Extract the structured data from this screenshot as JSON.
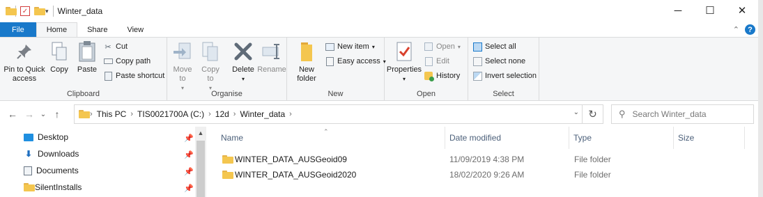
{
  "window": {
    "title": "Winter_data"
  },
  "tabs": [
    "File",
    "Home",
    "Share",
    "View"
  ],
  "ribbon": {
    "clipboard": {
      "label": "Clipboard",
      "pin_to_quick_access": "Pin to Quick access",
      "copy": "Copy",
      "paste": "Paste",
      "cut": "Cut",
      "copy_path": "Copy path",
      "paste_shortcut": "Paste shortcut"
    },
    "organise": {
      "label": "Organise",
      "move_to": "Move to",
      "copy_to": "Copy to",
      "delete": "Delete",
      "rename": "Rename"
    },
    "new": {
      "label": "New",
      "new_folder": "New folder",
      "new_item": "New item",
      "easy_access": "Easy access"
    },
    "open": {
      "label": "Open",
      "properties": "Properties",
      "open": "Open",
      "edit": "Edit",
      "history": "History"
    },
    "select": {
      "label": "Select",
      "select_all": "Select all",
      "select_none": "Select none",
      "invert_selection": "Invert selection"
    }
  },
  "address": {
    "crumbs": [
      "This PC",
      "TIS0021700A (C:)",
      "12d",
      "Winter_data"
    ],
    "search_placeholder": "Search Winter_data"
  },
  "nav_pane": [
    {
      "label": "Desktop",
      "icon": "desktop-icon"
    },
    {
      "label": "Downloads",
      "icon": "download-icon"
    },
    {
      "label": "Documents",
      "icon": "documents-icon"
    },
    {
      "label": "SilentInstalls",
      "icon": "folder-icon"
    }
  ],
  "columns": {
    "name": "Name",
    "date": "Date modified",
    "type": "Type",
    "size": "Size"
  },
  "files": [
    {
      "name": "WINTER_DATA_AUSGeoid09",
      "date": "11/09/2019 4:38 PM",
      "type": "File folder",
      "size": ""
    },
    {
      "name": "WINTER_DATA_AUSGeoid2020",
      "date": "18/02/2020 9:26 AM",
      "type": "File folder",
      "size": ""
    }
  ],
  "colors": {
    "accent": "#1979ca",
    "folder": "#f4c64f",
    "header_text": "#4c607a"
  }
}
